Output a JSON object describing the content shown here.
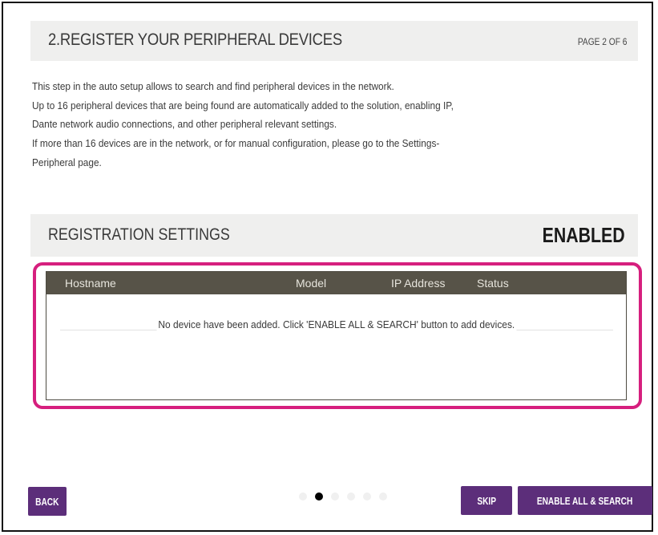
{
  "header": {
    "title": "2.REGISTER YOUR PERIPHERAL DEVICES",
    "page_indicator": "PAGE 2 OF 6"
  },
  "intro": {
    "lines": [
      "This step in the auto setup allows to search and find peripheral devices in the network.",
      "Up to 16 peripheral devices that are being found are automatically added to the solution, enabling IP,",
      "Dante network audio connections, and other peripheral relevant settings.",
      "If more than 16 devices are in the network, or for manual configuration, please go to the Settings-",
      "Peripheral page."
    ]
  },
  "registration": {
    "title": "REGISTRATION SETTINGS",
    "status": "ENABLED"
  },
  "device_table": {
    "columns": [
      "Hostname",
      "Model",
      "IP Address",
      "Status"
    ],
    "rows": [],
    "empty_message": "No device have been added. Click 'ENABLE ALL & SEARCH' button to add devices."
  },
  "pager": {
    "total_pages": 6,
    "current_page": 2
  },
  "buttons": {
    "back": "BACK",
    "skip": "SKIP",
    "enable_all": "ENABLE ALL & SEARCH"
  },
  "colors": {
    "accent": "#5c2e7a",
    "highlight": "#d61f7e",
    "table_header": "#575348",
    "section_bg": "#efefee"
  }
}
